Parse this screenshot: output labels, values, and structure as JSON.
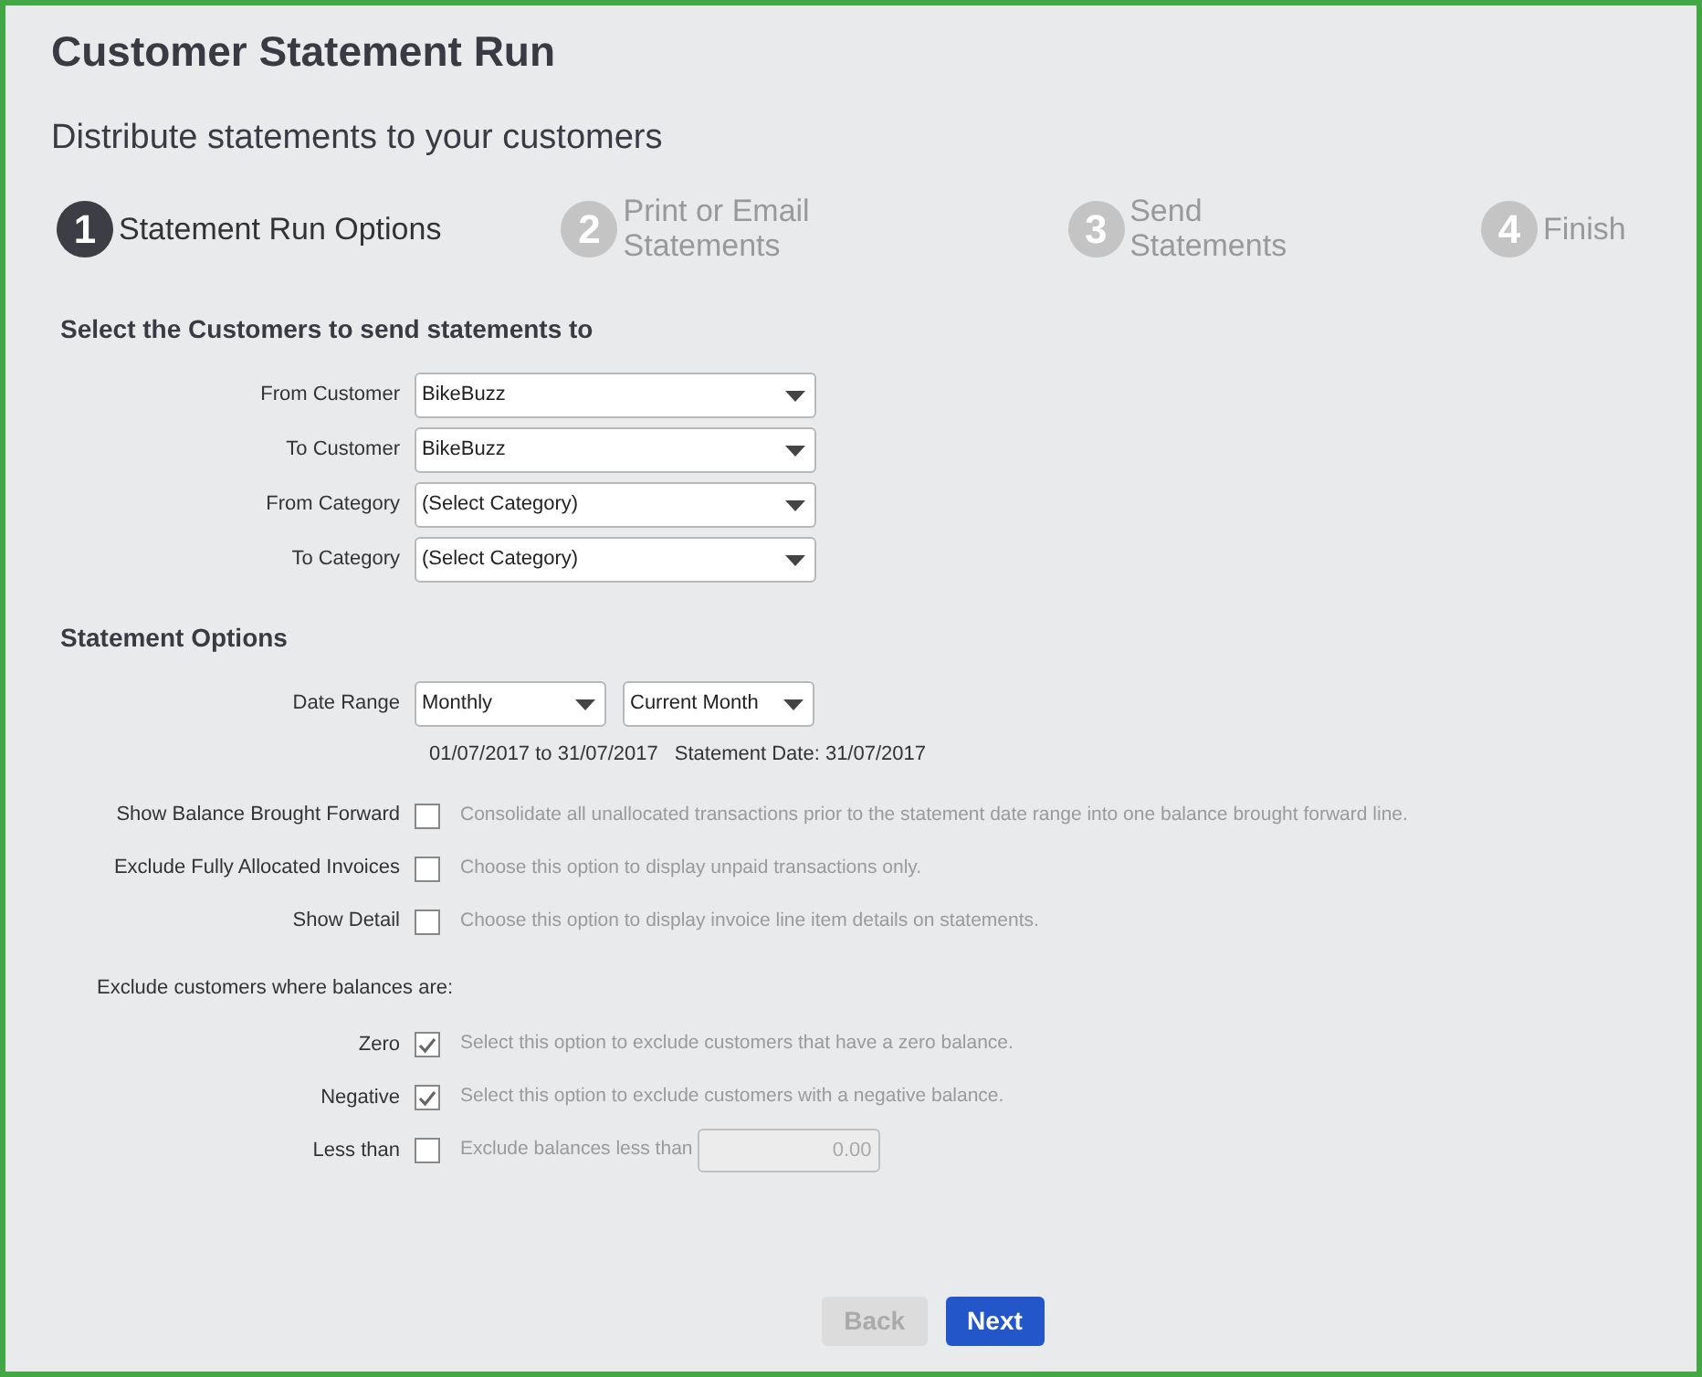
{
  "title": "Customer Statement Run",
  "subtitle": "Distribute statements to your customers",
  "steps": [
    {
      "number": "1",
      "label": "Statement Run Options",
      "selected": true
    },
    {
      "number": "2",
      "label": "Print or Email Statements",
      "selected": false
    },
    {
      "number": "3",
      "label": "Send Statements",
      "selected": false
    },
    {
      "number": "4",
      "label": "Finish",
      "selected": false
    }
  ],
  "customer_section": {
    "heading": "Select the Customers to send statements to",
    "fields": [
      {
        "label": "From Customer",
        "value": "BikeBuzz"
      },
      {
        "label": "To Customer",
        "value": "BikeBuzz"
      },
      {
        "label": "From Category",
        "value": "(Select Category)"
      },
      {
        "label": "To Category",
        "value": "(Select Category)"
      }
    ]
  },
  "options_section": {
    "heading": "Statement Options",
    "date_range": {
      "label": "Date Range",
      "period": "Monthly",
      "range": "Current Month",
      "dates": "01/07/2017 to 31/07/2017",
      "statement_date": "Statement Date: 31/07/2017"
    },
    "options": [
      {
        "label": "Show Balance Brought Forward",
        "checked": false,
        "description": "Consolidate all unallocated transactions prior to the statement date range into one balance brought forward line."
      },
      {
        "label": "Exclude Fully Allocated Invoices",
        "checked": false,
        "description": "Choose this option to display unpaid transactions only."
      },
      {
        "label": "Show Detail",
        "checked": false,
        "description": "Choose this option to display invoice line item details on statements."
      }
    ],
    "exclude_heading": "Exclude customers where balances are:",
    "exclude_options": [
      {
        "kind": "check",
        "label": "Zero",
        "checked": true,
        "description": "Select this option to exclude customers that have a zero balance."
      },
      {
        "kind": "check",
        "label": "Negative",
        "checked": true,
        "description": "Select this option to exclude customers with a negative balance."
      },
      {
        "kind": "threshold",
        "label": "Less than",
        "checked": false,
        "description": "Exclude balances less than",
        "value": "0.00"
      }
    ]
  },
  "buttons": [
    {
      "label": "Back",
      "disabled": true
    },
    {
      "label": "Next",
      "disabled": false
    }
  ]
}
